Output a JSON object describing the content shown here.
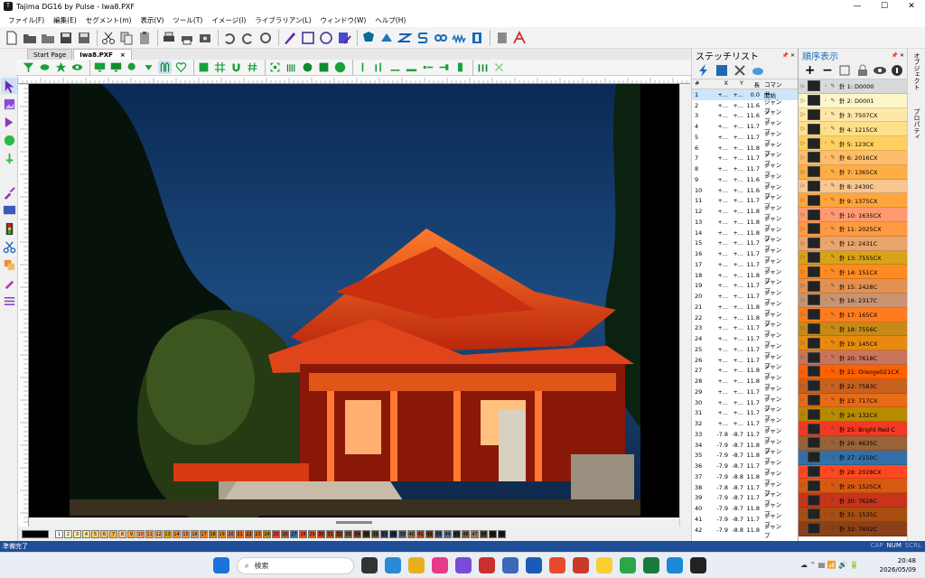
{
  "window": {
    "title": "Tajima DG16 by Pulse - Iwa8.PXF",
    "minimize": "—",
    "maximize": "☐",
    "close": "✕"
  },
  "menu": [
    "ファイル(F)",
    "編集(E)",
    "セグメント(m)",
    "表示(V)",
    "ツール(T)",
    "イメージ(I)",
    "ライブラリアン(L)",
    "ウィンドウ(W)",
    "ヘルプ(H)"
  ],
  "tabs": [
    {
      "label": "Start Page",
      "close": ""
    },
    {
      "label": "Iwa8.PXF",
      "close": "×"
    }
  ],
  "stitch_list": {
    "title": "ステッチリスト",
    "pin": "📌 ✕",
    "columns": [
      "#",
      "X",
      "Y",
      "長",
      "コマンド"
    ],
    "rows": [
      [
        "1",
        "+...",
        "+...",
        "0.0",
        "開始"
      ],
      [
        "2",
        "+...",
        "+...",
        "11.6",
        "ジャンプ"
      ],
      [
        "3",
        "+...",
        "+...",
        "11.6",
        "ジャンプ"
      ],
      [
        "4",
        "+...",
        "+...",
        "11.7",
        "ジャンプ"
      ],
      [
        "5",
        "+...",
        "+...",
        "11.7",
        "ジャンプ"
      ],
      [
        "6",
        "+...",
        "+...",
        "11.8",
        "ジャンプ"
      ],
      [
        "7",
        "+...",
        "+...",
        "11.7",
        "ジャンプ"
      ],
      [
        "8",
        "+...",
        "+...",
        "11.7",
        "ジャンプ"
      ],
      [
        "9",
        "+...",
        "+...",
        "11.6",
        "ジャンプ"
      ],
      [
        "10",
        "+...",
        "+...",
        "11.6",
        "ジャンプ"
      ],
      [
        "11",
        "+...",
        "+...",
        "11.7",
        "ジャンプ"
      ],
      [
        "12",
        "+...",
        "+...",
        "11.8",
        "ジャンプ"
      ],
      [
        "13",
        "+...",
        "+...",
        "11.8",
        "ジャンプ"
      ],
      [
        "14",
        "+...",
        "+...",
        "11.8",
        "ジャンプ"
      ],
      [
        "15",
        "+...",
        "+...",
        "11.7",
        "ジャンプ"
      ],
      [
        "16",
        "+...",
        "+...",
        "11.7",
        "ジャンプ"
      ],
      [
        "17",
        "+...",
        "+...",
        "11.7",
        "ジャンプ"
      ],
      [
        "18",
        "+...",
        "+...",
        "11.8",
        "ジャンプ"
      ],
      [
        "19",
        "+...",
        "+...",
        "11.7",
        "ジャンプ"
      ],
      [
        "20",
        "+...",
        "+...",
        "11.7",
        "ジャンプ"
      ],
      [
        "21",
        "+...",
        "+...",
        "11.8",
        "ジャンプ"
      ],
      [
        "22",
        "+...",
        "+...",
        "11.8",
        "ジャンプ"
      ],
      [
        "23",
        "+...",
        "+...",
        "11.7",
        "ジャンプ"
      ],
      [
        "24",
        "+...",
        "+...",
        "11.7",
        "ジャンプ"
      ],
      [
        "25",
        "+...",
        "+...",
        "11.7",
        "ジャンプ"
      ],
      [
        "26",
        "+...",
        "+...",
        "11.7",
        "ジャンプ"
      ],
      [
        "27",
        "+...",
        "+...",
        "11.8",
        "ジャンプ"
      ],
      [
        "28",
        "+...",
        "+...",
        "11.8",
        "ジャンプ"
      ],
      [
        "29",
        "+...",
        "+...",
        "11.7",
        "ジャンプ"
      ],
      [
        "30",
        "+...",
        "+...",
        "11.7",
        "ジャンプ"
      ],
      [
        "31",
        "+...",
        "+...",
        "11.7",
        "ジャンプ"
      ],
      [
        "32",
        "+...",
        "+...",
        "11.7",
        "ジャンプ"
      ],
      [
        "33",
        "-7.8",
        "-8.7",
        "11.7",
        "ジャンプ"
      ],
      [
        "34",
        "-7.9",
        "-8.7",
        "11.8",
        "ジャンプ"
      ],
      [
        "35",
        "-7.9",
        "-8.7",
        "11.8",
        "ジャンプ"
      ],
      [
        "36",
        "-7.9",
        "-8.7",
        "11.7",
        "ジャンプ"
      ],
      [
        "37",
        "-7.9",
        "-8.8",
        "11.8",
        "ジャンプ"
      ],
      [
        "38",
        "-7.8",
        "-8.7",
        "11.7",
        "ジャンプ"
      ],
      [
        "39",
        "-7.9",
        "-8.7",
        "11.7",
        "ジャンプ"
      ],
      [
        "40",
        "-7.9",
        "-8.7",
        "11.8",
        "ジャンプ"
      ],
      [
        "41",
        "-7.9",
        "-8.7",
        "11.7",
        "ジャンプ"
      ],
      [
        "42",
        "-7.9",
        "-8.8",
        "11.8",
        "ジャンプ"
      ]
    ]
  },
  "sequence": {
    "title": "順序表示",
    "pin": "📌 ✕",
    "items": [
      {
        "label": "針 1: D0000",
        "color": "#d9d9d9"
      },
      {
        "label": "針 2: D0001",
        "color": "#fff6c8"
      },
      {
        "label": "針 3: 7507CX",
        "color": "#ffe7a8"
      },
      {
        "label": "針 4: 1215CX",
        "color": "#ffe08a"
      },
      {
        "label": "針 5: 123CX",
        "color": "#ffd060"
      },
      {
        "label": "針 6: 2016CX",
        "color": "#ffbd6b"
      },
      {
        "label": "針 7: 1365CX",
        "color": "#ffae45"
      },
      {
        "label": "針 8: 2430C",
        "color": "#f8c68e"
      },
      {
        "label": "針 9: 1375CX",
        "color": "#ffa53c"
      },
      {
        "label": "針 10: 1635CX",
        "color": "#ff9a70"
      },
      {
        "label": "針 11: 2025CX",
        "color": "#ff9a40"
      },
      {
        "label": "針 12: 2431C",
        "color": "#e9a56c"
      },
      {
        "label": "針 13: 7555CX",
        "color": "#d9a318"
      },
      {
        "label": "針 14: 151CX",
        "color": "#ff8a22"
      },
      {
        "label": "針 15: 2428C",
        "color": "#e39151"
      },
      {
        "label": "針 16: 2317C",
        "color": "#c89370"
      },
      {
        "label": "針 17: 165CX",
        "color": "#ff7c1e"
      },
      {
        "label": "針 18: 7556C",
        "color": "#c78a18"
      },
      {
        "label": "針 19: 145CX",
        "color": "#e88a10"
      },
      {
        "label": "針 20: 7618C",
        "color": "#c8755a"
      },
      {
        "label": "針 21: Oreoge021CX",
        "color": "#ff6000"
      },
      {
        "label": "針 22: 7583C",
        "color": "#c8601e"
      },
      {
        "label": "針 23: 717CX",
        "color": "#e86c16"
      },
      {
        "label": "針 24: 132CX",
        "color": "#b88a00"
      },
      {
        "label": "針 25: Bright Red C",
        "color": "#f03a24"
      },
      {
        "label": "針 26: 4635C",
        "color": "#9a6238"
      },
      {
        "label": "針 27: 2150C",
        "color": "#3470a8"
      },
      {
        "label": "針 28: 2028CX",
        "color": "#ff4820"
      },
      {
        "label": "針 29: 1525CX",
        "color": "#d85a10"
      },
      {
        "label": "針 30: 7626C",
        "color": "#c8341a"
      },
      {
        "label": "針 31: 1535C",
        "color": "#a84e10"
      },
      {
        "label": "針 32: 7602C",
        "color": "#8a4018"
      }
    ]
  },
  "properties": {
    "label": "プロパティ",
    "label2": "オブジェクト"
  },
  "palette": {
    "numbers": [
      "1",
      "2",
      "3",
      "4",
      "5",
      "6",
      "7",
      "8",
      "9",
      "10",
      "11",
      "12",
      "13",
      "14",
      "15",
      "16",
      "17",
      "18",
      "19",
      "20",
      "21",
      "22",
      "23",
      "24",
      "25",
      "26",
      "27",
      "28",
      "29",
      "30",
      "31",
      "32",
      "33",
      "34",
      "35",
      "36",
      "37",
      "38",
      "39",
      "40",
      "41",
      "42",
      "43",
      "44",
      "45",
      "46",
      "47",
      "48",
      "49",
      "50"
    ],
    "colors": [
      "#ffffff",
      "#fff6c8",
      "#ffe7a8",
      "#ffe08a",
      "#ffd060",
      "#ffbd6b",
      "#ffae45",
      "#f8c68e",
      "#ffa53c",
      "#ff9a70",
      "#ff9a40",
      "#e9a56c",
      "#d9a318",
      "#ff8a22",
      "#e39151",
      "#c89370",
      "#ff7c1e",
      "#c78a18",
      "#e88a10",
      "#c8755a",
      "#ff6000",
      "#c8601e",
      "#e86c16",
      "#b88a00",
      "#f03a24",
      "#9a6238",
      "#3470a8",
      "#ff4820",
      "#d85a10",
      "#c8341a",
      "#a84e10",
      "#8a4018",
      "#6a5a3a",
      "#7a3a20",
      "#3a2a1a",
      "#5a4a30",
      "#2a3a5a",
      "#1a2a4a",
      "#4a5a6a",
      "#8a6a40",
      "#aa4a20",
      "#6a3a1a",
      "#3a4a6a",
      "#5a6a8a",
      "#2a2a3a",
      "#7a5a4a",
      "#9a7a5a",
      "#4a3a2a",
      "#2a1a1a",
      "#1a1a2a"
    ]
  },
  "status": {
    "text": "準備完了",
    "caps": "CAP",
    "num": "NUM",
    "scrl": "SCRL"
  },
  "taskbar": {
    "search": "検索",
    "time": "20:48",
    "date": "2026/05/09"
  }
}
